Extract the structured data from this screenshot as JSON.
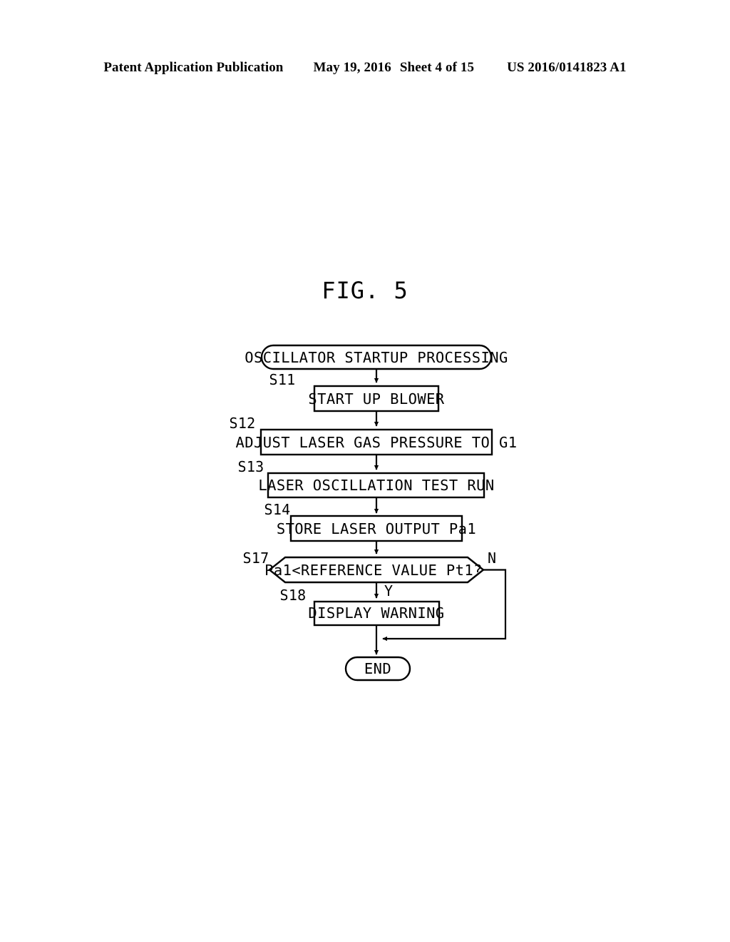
{
  "header": {
    "publication": "Patent Application Publication",
    "date": "May 19, 2016",
    "sheet": "Sheet 4 of 15",
    "patent_number": "US 2016/0141823 A1"
  },
  "figure": {
    "title": "FIG. 5"
  },
  "flowchart": {
    "start": {
      "shape": "terminator",
      "label": "OSCILLATOR STARTUP PROCESSING"
    },
    "steps": [
      {
        "id": "S11",
        "shape": "process",
        "label": "START UP BLOWER"
      },
      {
        "id": "S12",
        "shape": "process",
        "label": "ADJUST LASER GAS PRESSURE TO G1"
      },
      {
        "id": "S13",
        "shape": "process",
        "label": "LASER OSCILLATION TEST RUN"
      },
      {
        "id": "S14",
        "shape": "process",
        "label": "STORE LASER OUTPUT Pa1"
      },
      {
        "id": "S17",
        "shape": "decision",
        "label": "Pa1<REFERENCE VALUE Pt1?"
      },
      {
        "id": "S18",
        "shape": "process",
        "label": "DISPLAY WARNING"
      }
    ],
    "branches": {
      "yes": "Y",
      "no": "N"
    },
    "end": {
      "shape": "terminator",
      "label": "END"
    },
    "colors": {
      "ink": "#000000",
      "paper": "#ffffff"
    }
  }
}
